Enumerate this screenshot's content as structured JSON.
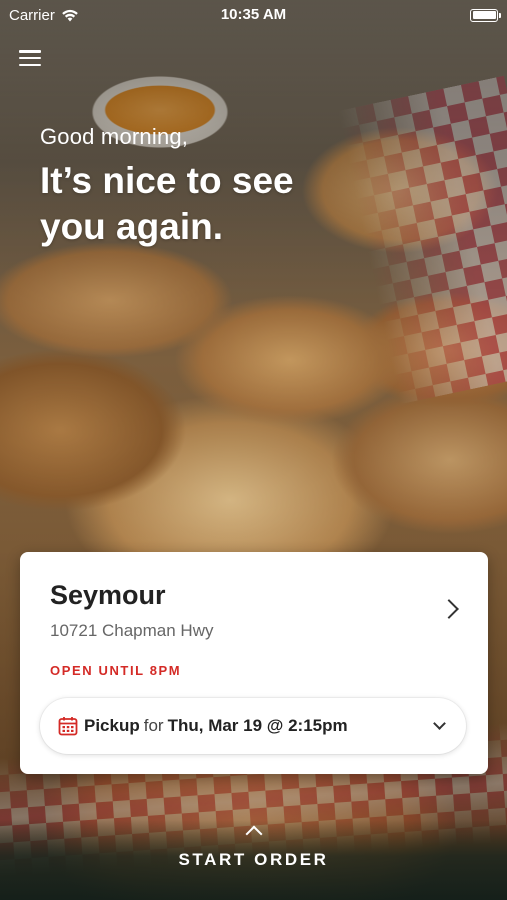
{
  "status_bar": {
    "carrier": "Carrier",
    "time": "10:35 AM"
  },
  "greeting": {
    "small": "Good morning,",
    "large": "It’s nice to see you again."
  },
  "location": {
    "name": "Seymour",
    "address": "10721 Chapman Hwy",
    "open_status": "OPEN UNTIL 8PM"
  },
  "order": {
    "mode": "Pickup",
    "for_label": "for",
    "datetime": "Thu, Mar 19 @ 2:15pm"
  },
  "cta": {
    "label": "START ORDER"
  },
  "colors": {
    "accent_red": "#d42a26",
    "card_background": "#ffffff",
    "text_dark": "#222222"
  },
  "icons": [
    "wifi-icon",
    "battery-icon",
    "menu-icon",
    "chevron-right-icon",
    "calendar-icon",
    "chevron-down-icon",
    "chevron-up-icon"
  ]
}
